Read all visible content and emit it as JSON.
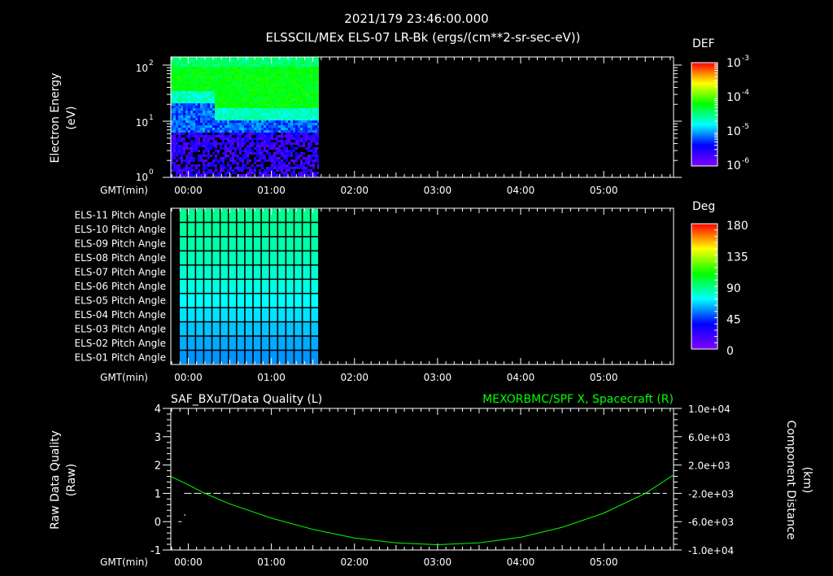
{
  "header": {
    "datetime": "2021/179 23:46:00.000",
    "title": "ELSSCIL/MEx ELS-07 LR-Bk  (ergs/(cm**2-sr-sec-eV))"
  },
  "time_axis": {
    "label": "GMT(min)",
    "ticks": [
      "00:00",
      "01:00",
      "02:00",
      "03:00",
      "04:00",
      "05:00"
    ],
    "range_hours": [
      -0.21,
      5.84
    ]
  },
  "colors": {
    "background": "#000000",
    "axis": "#ffffff",
    "trace": "#00ff00"
  },
  "chart_data": [
    {
      "type": "heatmap",
      "title": "ELSSCIL/MEx ELS-07 LR-Bk  (ergs/(cm**2-sr-sec-eV))",
      "ylabel": [
        "Electron Energy",
        "(eV)"
      ],
      "yscale": "log",
      "ylim": [
        1,
        145
      ],
      "yticks": [
        {
          "base": "10",
          "exp": "2",
          "value": 100
        },
        {
          "base": "10",
          "exp": "1",
          "value": 10
        },
        {
          "base": "10",
          "exp": "0",
          "value": 1
        }
      ],
      "data_time_range_hours": [
        -0.21,
        1.57
      ],
      "colorbar": {
        "label": "DEF",
        "scale": "log",
        "range": [
          1e-06,
          0.001
        ],
        "ticks": [
          {
            "base": "10",
            "exp": "-3"
          },
          {
            "base": "10",
            "exp": "-4"
          },
          {
            "base": "10",
            "exp": "-5"
          },
          {
            "base": "10",
            "exp": "-6"
          }
        ]
      }
    },
    {
      "type": "heatmap",
      "rows": [
        "ELS-11 Pitch Angle",
        "ELS-10 Pitch Angle",
        "ELS-09 Pitch Angle",
        "ELS-08 Pitch Angle",
        "ELS-07 Pitch Angle",
        "ELS-06 Pitch Angle",
        "ELS-05 Pitch Angle",
        "ELS-04 Pitch Angle",
        "ELS-03 Pitch Angle",
        "ELS-02 Pitch Angle",
        "ELS-01 Pitch Angle"
      ],
      "row_values_deg": [
        88,
        86,
        84,
        82,
        79,
        76,
        72,
        68,
        64,
        60,
        57
      ],
      "data_time_range_hours": [
        -0.11,
        1.57
      ],
      "columns": 17,
      "colorbar": {
        "label": "Deg",
        "range": [
          0,
          180
        ],
        "ticks": [
          "180",
          "135",
          "90",
          "45",
          "0"
        ]
      }
    },
    {
      "type": "line",
      "title_left": "SAF_BXuT/Data Quality (L)",
      "title_right": "MEXORBMC/SPF X, Spacecraft (R)",
      "ylabel_left": [
        "Raw Data Quality",
        "(Raw)"
      ],
      "ylabel_right": [
        "Component Distance",
        "(km)"
      ],
      "ylim_left": [
        -1,
        4
      ],
      "yticks_left": [
        "4",
        "3",
        "2",
        "1",
        "0",
        "-1"
      ],
      "ylim_right": [
        -10000,
        10000
      ],
      "yticks_right": [
        "1.0e+04",
        "6.0e+03",
        "2.0e+03",
        "-2.0e+03",
        "-6.0e+03",
        "-1.0e+04"
      ],
      "series": [
        {
          "name": "Data Quality",
          "axis": "left",
          "style": "dashed",
          "color": "#ffffff",
          "x": [
            -0.05,
            5.76
          ],
          "y": [
            1,
            1
          ]
        },
        {
          "name": "Data Quality (early)",
          "axis": "left",
          "color": "#ffffff",
          "x": [
            -0.12,
            -0.08
          ],
          "y": [
            0,
            0
          ]
        },
        {
          "name": "MEXORBMC/SPF X",
          "axis": "right",
          "color": "#00ff00",
          "x": [
            -0.21,
            0,
            0.2,
            0.5,
            1,
            1.5,
            2,
            2.5,
            3,
            3.5,
            4,
            4.5,
            5,
            5.5,
            5.84
          ],
          "y": [
            400,
            -800,
            -2000,
            -3500,
            -5500,
            -7100,
            -8300,
            -9000,
            -9250,
            -9000,
            -8200,
            -6800,
            -4800,
            -2000,
            600
          ]
        }
      ]
    }
  ]
}
